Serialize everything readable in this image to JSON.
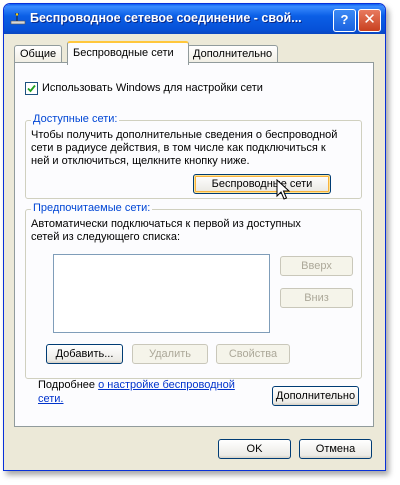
{
  "window": {
    "title": "Беспроводное сетевое соединение - свой...",
    "help_label": "?",
    "close_label": "✕"
  },
  "tabs": [
    {
      "label": "Общие"
    },
    {
      "label": "Беспроводные сети"
    },
    {
      "label": "Дополнительно"
    }
  ],
  "use_windows": {
    "label": "Использовать Windows для настройки сети",
    "checked": true
  },
  "available": {
    "title": "Доступные сети:",
    "description": "Чтобы получить дополнительные сведения о беспроводной\nсети в радиусе действия, в том числе как подключиться к\nней и отключиться, щелкните кнопку ниже.",
    "button": "Беспроводные сети"
  },
  "preferred": {
    "title": "Предпочитаемые сети:",
    "description": "Автоматически подключаться к первой из доступных\nсетей из следующего списка:",
    "up": "Вверх",
    "down": "Вниз",
    "add": "Добавить...",
    "remove": "Удалить",
    "properties": "Свойства"
  },
  "more_info": {
    "prefix": "Подробнее ",
    "link_line1": "о настройке  беспроводной",
    "link_line2": "сети.",
    "advanced_button": "Дополнительно"
  },
  "footer": {
    "ok": "OK",
    "cancel": "Отмена"
  }
}
